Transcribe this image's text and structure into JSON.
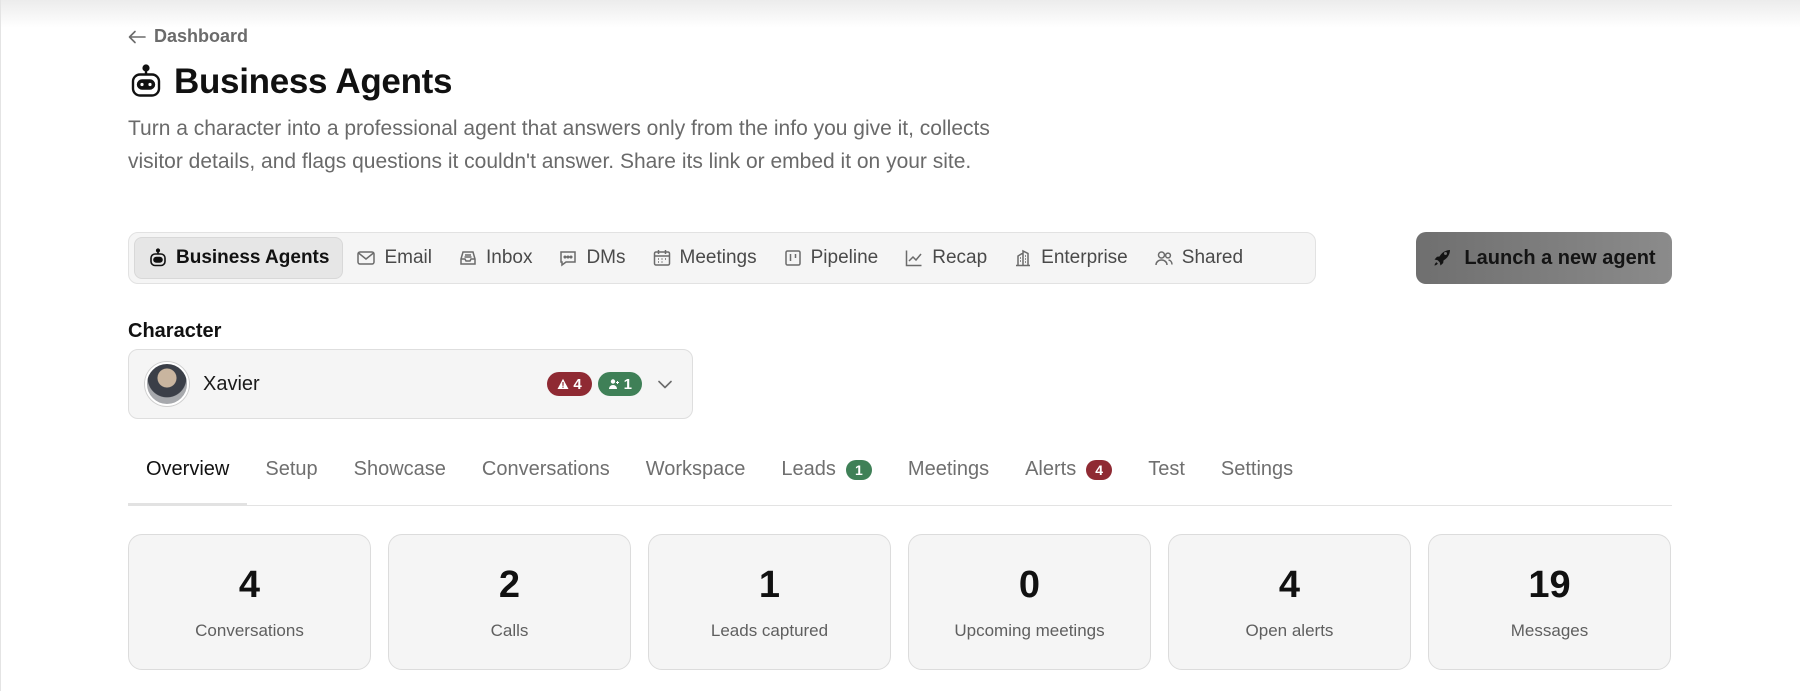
{
  "back": {
    "label": "Dashboard"
  },
  "header": {
    "title": "Business Agents",
    "description": "Turn a character into a professional agent that answers only from the info you give it, collects visitor details, and flags questions it couldn't answer. Share its link or embed it on your site."
  },
  "nav": {
    "items": [
      {
        "label": "Business Agents",
        "icon": "robot-icon",
        "active": true
      },
      {
        "label": "Email",
        "icon": "mail-icon"
      },
      {
        "label": "Inbox",
        "icon": "inbox-icon"
      },
      {
        "label": "DMs",
        "icon": "message-icon"
      },
      {
        "label": "Meetings",
        "icon": "calendar-icon"
      },
      {
        "label": "Pipeline",
        "icon": "kanban-icon"
      },
      {
        "label": "Recap",
        "icon": "chart-line-icon"
      },
      {
        "label": "Enterprise",
        "icon": "building-icon"
      },
      {
        "label": "Shared",
        "icon": "users-icon"
      }
    ]
  },
  "launch": {
    "label": "Launch a new agent"
  },
  "character": {
    "label": "Character",
    "name": "Xavier",
    "alerts_count": "4",
    "leads_count": "1"
  },
  "tabs": {
    "items": [
      {
        "label": "Overview",
        "active": true
      },
      {
        "label": "Setup"
      },
      {
        "label": "Showcase"
      },
      {
        "label": "Conversations"
      },
      {
        "label": "Workspace"
      },
      {
        "label": "Leads",
        "badge": "1",
        "badge_color": "#3f8057"
      },
      {
        "label": "Meetings"
      },
      {
        "label": "Alerts",
        "badge": "4",
        "badge_color": "#8f2a33"
      },
      {
        "label": "Test"
      },
      {
        "label": "Settings"
      }
    ]
  },
  "stats": [
    {
      "value": "4",
      "label": "Conversations"
    },
    {
      "value": "2",
      "label": "Calls"
    },
    {
      "value": "1",
      "label": "Leads captured"
    },
    {
      "value": "0",
      "label": "Upcoming meetings"
    },
    {
      "value": "4",
      "label": "Open alerts"
    },
    {
      "value": "19",
      "label": "Messages"
    }
  ],
  "colors": {
    "alert_red": "#8f2a33",
    "lead_green": "#3f8057",
    "launch_button": "#7a7a7a"
  }
}
